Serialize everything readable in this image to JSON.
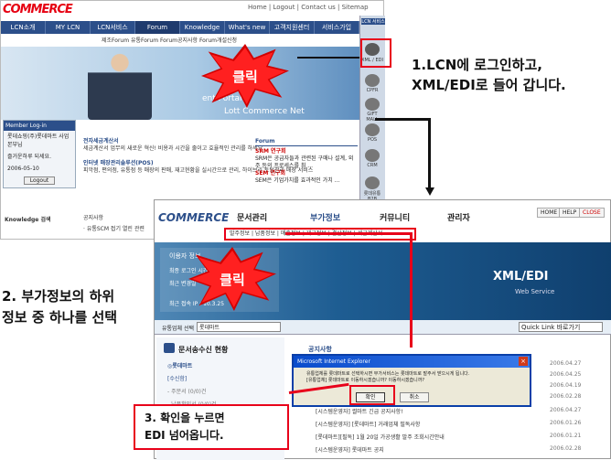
{
  "lcn": {
    "logo": "COMMERCE",
    "top_links": "Home | Logout | Contact us | Sitemap",
    "nav": [
      "LCN소개",
      "MY LCN",
      "LCN서비스",
      "Forum",
      "Knowledge",
      "What's new",
      "고객지원센터",
      "서비스가입"
    ],
    "subnav": "제조Forum 유통Forum Forum공지사항 Forum개설신청",
    "portal": "ent Portal",
    "commerce_net": "Lott Commerce Net",
    "side_title": "LCN 서비스",
    "side_icons": [
      {
        "icon": "xml-edi-icon",
        "label": "XML / EDI"
      },
      {
        "icon": "cpfr-icon",
        "label": "CPFR"
      },
      {
        "icon": "gift-mall-icon",
        "label": "GIFT MALL"
      },
      {
        "icon": "pos-icon",
        "label": "POS"
      },
      {
        "icon": "crm-icon",
        "label": "CRM"
      },
      {
        "icon": "b2b-icon",
        "label": "롯데유통 B2B"
      }
    ],
    "member": {
      "title": "Member Log-in",
      "l1": "롯데쇼핑(주)롯데마트 사업본부님",
      "l2": "즐거운하루 되세요.",
      "l3": "2006-05-10",
      "logout": "Logout"
    },
    "services": [
      {
        "title": "전자세금계산서",
        "desc": "세금계산서 업무의 새로운 혁신! 비용과 시간을 줄이고 효율적인 관리를 하세요"
      },
      {
        "title": "인터넷 매장관리솔루션(POS)",
        "desc": "피악점, 편의점, 유통점 등 매장의 판매, 재고현황을 실시간으로 관리, 하이브리 토털관리 매장 서비스"
      }
    ],
    "forum": {
      "title": "Forum",
      "t1": "SRM 연구회",
      "d1": "SRM은 공급자들과 관련된 구매나 설계, 외주 등의 프로세스를 최 ...",
      "t2": "SEM 연구회",
      "d2": "SEM은 기업가치를 효과적인 가치 ..."
    },
    "knowledge": "Knowledge 검색",
    "notice": "공지사항",
    "notice_item": "· 유통SCM 접기 열린 관련"
  },
  "click1": "클릭",
  "label1": [
    "1.LCN에 로그인하고,",
    "XML/EDI로 들어 갑니다."
  ],
  "label2": [
    "2. 부가정보의 하위",
    "정보 중 하나를 선택"
  ],
  "label3": [
    "3. 확인을 누르면",
    "EDI 넘어옵니다."
  ],
  "bz": {
    "logo": "COMMERCE",
    "tabs": [
      "문서관리",
      "부가정보",
      "커뮤니티",
      "관리자"
    ],
    "top_btns": [
      "HOME",
      "HELP",
      "CLOSE"
    ],
    "subnav": "발주정보 | 납품정보 | 매출정보 | 재고정보 | 결산정보 | 세금계산서",
    "xml": "XML/EDI",
    "ws": "Web Service",
    "retailer_label": "유통업체 선택",
    "retailer_value": "롯데마트",
    "quick": "Quick Link 바로가기",
    "doc_title": "문서송수신 현황",
    "side": [
      "◎롯데마트",
      "[수신함]",
      "- 주문서 (0/0)건",
      "- 납품확인서 (0/0)건"
    ],
    "notice_title": "공지사항",
    "notices": [
      {
        "t": "[시스템운영자] 썰마트 긴급 공지사항!",
        "d": "2006.04.27"
      },
      {
        "t": "[시스템운영자] [롯데마트] 거래업체 필독사항",
        "d": "2006.04.25"
      },
      {
        "t": "[롯데마트][필독] 1월 20일 가공생활 발주 조회시간안내",
        "d": "2006.04.19"
      },
      {
        "t": "[시스템운영자] 롯데마트 공지",
        "d": "2006.02.28"
      },
      {
        "t": "[시스템운영자] 공지",
        "d": "2006.01.21"
      }
    ],
    "dates": [
      "2006.04.27",
      "2006.04.25",
      "2006.04.19",
      "2006.02.28",
      "2006.01.26",
      "2006.01.21"
    ]
  },
  "click2": "클릭",
  "left_info": {
    "title": "이용자 정보",
    "l1": "최종 로그인 시간",
    "l2": "최근 변경일",
    "l3": "최근 접속 IP : 10.3.25"
  },
  "dialog": {
    "title": "Microsoft Internet Explorer",
    "msg1": "유통업체를 롯데마트로 선택하시면 부가서비스는 롯데마트로 발주서 받으시게 됩니다.",
    "msg2": "[유통업체] 롯데마트로 이동하시겠습니까? 이동하시겠습니까?",
    "ok": "확인",
    "cancel": "취소"
  }
}
